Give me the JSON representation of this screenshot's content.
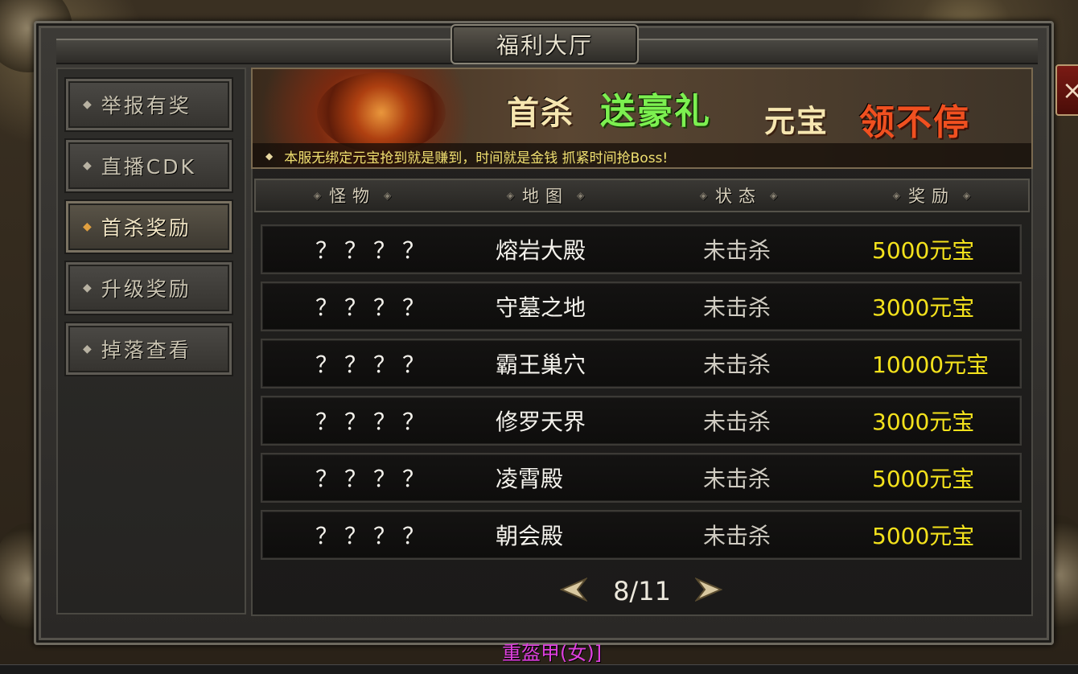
{
  "window": {
    "title": "福利大厅",
    "close_icon": "×"
  },
  "sidebar": {
    "items": [
      {
        "label": "举报有奖",
        "active": false
      },
      {
        "label": "直播CDK",
        "active": false
      },
      {
        "label": "首杀奖励",
        "active": true
      },
      {
        "label": "升级奖励",
        "active": false
      },
      {
        "label": "掉落查看",
        "active": false
      }
    ]
  },
  "banner": {
    "headline_1": "首杀",
    "headline_2": "送豪礼",
    "headline_3": "元宝",
    "headline_4": "领不停",
    "notice": "本服无绑定元宝抢到就是赚到，时间就是金钱 抓紧时间抢Boss!"
  },
  "table": {
    "headers": [
      "怪物",
      "地图",
      "状态",
      "奖励"
    ],
    "rows": [
      {
        "monster": "？？？？",
        "map": "熔岩大殿",
        "status": "未击杀",
        "reward": "5000元宝"
      },
      {
        "monster": "？？？？",
        "map": "守墓之地",
        "status": "未击杀",
        "reward": "3000元宝"
      },
      {
        "monster": "？？？？",
        "map": "霸王巢穴",
        "status": "未击杀",
        "reward": "10000元宝"
      },
      {
        "monster": "？？？？",
        "map": "修罗天界",
        "status": "未击杀",
        "reward": "3000元宝"
      },
      {
        "monster": "？？？？",
        "map": "凌霄殿",
        "status": "未击杀",
        "reward": "5000元宝"
      },
      {
        "monster": "？？？？",
        "map": "朝会殿",
        "status": "未击杀",
        "reward": "5000元宝"
      }
    ]
  },
  "pager": {
    "text": "8/11"
  },
  "footer": {
    "item_name": "重盔甲(女)]"
  },
  "colors": {
    "reward": "#f4e21c",
    "item_name": "#e040e0",
    "banner_green": "#7cf050",
    "banner_red": "#f05020"
  }
}
